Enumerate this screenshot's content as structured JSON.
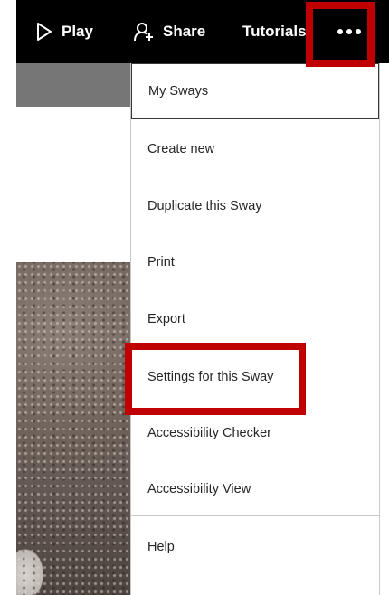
{
  "toolbar": {
    "play_label": "Play",
    "share_label": "Share",
    "tutorials_label": "Tutorials",
    "play_icon": "play-icon",
    "share_icon": "share-icon",
    "more_icon": "more-options-icon"
  },
  "menu": {
    "items": [
      {
        "label": "My Sways"
      },
      {
        "label": "Create new"
      },
      {
        "label": "Duplicate this Sway"
      },
      {
        "label": "Print"
      },
      {
        "label": "Export"
      },
      {
        "label": "Settings for this Sway"
      },
      {
        "label": "Accessibility Checker"
      },
      {
        "label": "Accessibility View"
      },
      {
        "label": "Help"
      }
    ]
  },
  "colors": {
    "toolbar_bg": "#000000",
    "highlight": "#c00000",
    "band_gray": "#767676",
    "menu_text": "#262626"
  }
}
